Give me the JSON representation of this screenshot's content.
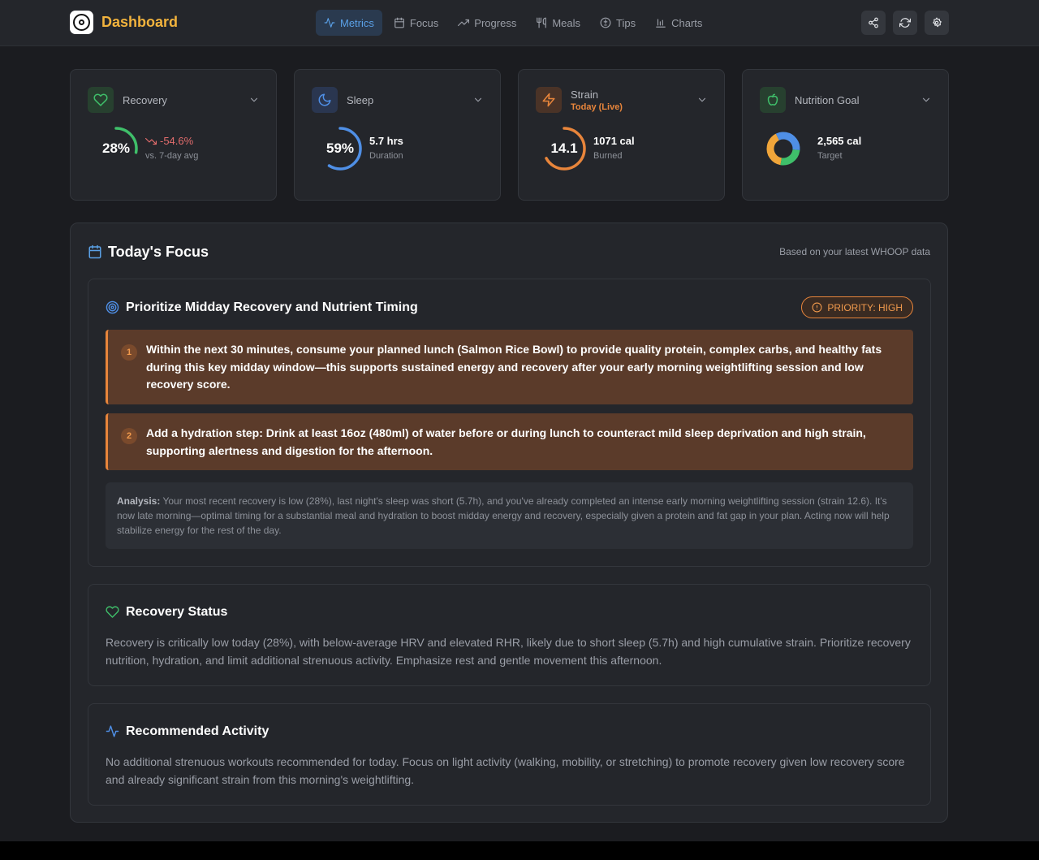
{
  "app": {
    "title": "Dashboard"
  },
  "nav": {
    "items": [
      {
        "label": "Metrics",
        "icon": "activity-icon",
        "active": true
      },
      {
        "label": "Focus",
        "icon": "calendar-icon",
        "active": false
      },
      {
        "label": "Progress",
        "icon": "trending-up-icon",
        "active": false
      },
      {
        "label": "Meals",
        "icon": "utensils-icon",
        "active": false
      },
      {
        "label": "Tips",
        "icon": "lightbulb-icon",
        "active": false
      },
      {
        "label": "Charts",
        "icon": "bar-chart-icon",
        "active": false
      }
    ]
  },
  "header_actions": [
    "share-icon",
    "refresh-icon",
    "settings-icon"
  ],
  "metrics": {
    "recovery": {
      "title": "Recovery",
      "value": "28%",
      "level": 0.28,
      "trend": "-54.6%",
      "trend_label": "vs. 7-day avg",
      "color": "#3fbf6a"
    },
    "sleep": {
      "title": "Sleep",
      "value": "59%",
      "level": 0.59,
      "detail": "5.7 hrs",
      "detail_label": "Duration",
      "color": "#4f8fe6"
    },
    "strain": {
      "title": "Strain",
      "subtitle": "Today (Live)",
      "value": "14.1",
      "level": 0.67,
      "detail": "1071 cal",
      "detail_label": "Burned",
      "color": "#e8853b"
    },
    "nutrition": {
      "title": "Nutrition Goal",
      "detail": "2,565 cal",
      "detail_label": "Target",
      "color": "#3fbf6a"
    }
  },
  "focus": {
    "title": "Today's Focus",
    "note": "Based on your latest WHOOP data",
    "main": {
      "title": "Prioritize Midday Recovery and Nutrient Timing",
      "priority": "PRIORITY: HIGH",
      "steps": [
        {
          "num": "1",
          "text": "Within the next 30 minutes, consume your planned lunch (Salmon Rice Bowl) to provide quality protein, complex carbs, and healthy fats during this key midday window—this supports sustained energy and recovery after your early morning weightlifting session and low recovery score."
        },
        {
          "num": "2",
          "text": "Add a hydration step: Drink at least 16oz (480ml) of water before or during lunch to counteract mild sleep deprivation and high strain, supporting alertness and digestion for the afternoon."
        }
      ],
      "analysis_label": "Analysis:",
      "analysis_text": "Your most recent recovery is low (28%), last night's sleep was short (5.7h), and you've already completed an intense early morning weightlifting session (strain 12.6). It's now late morning—optimal timing for a substantial meal and hydration to boost midday energy and recovery, especially given a protein and fat gap in your plan. Acting now will help stabilize energy for the rest of the day."
    },
    "recovery_status": {
      "title": "Recovery Status",
      "text": "Recovery is critically low today (28%), with below-average HRV and elevated RHR, likely due to short sleep (5.7h) and high cumulative strain. Prioritize recovery nutrition, hydration, and limit additional strenuous activity. Emphasize rest and gentle movement this afternoon."
    },
    "activity": {
      "title": "Recommended Activity",
      "text": "No additional strenuous workouts recommended for today. Focus on light activity (walking, mobility, or stretching) to promote recovery given low recovery score and already significant strain from this morning's weightlifting."
    }
  }
}
